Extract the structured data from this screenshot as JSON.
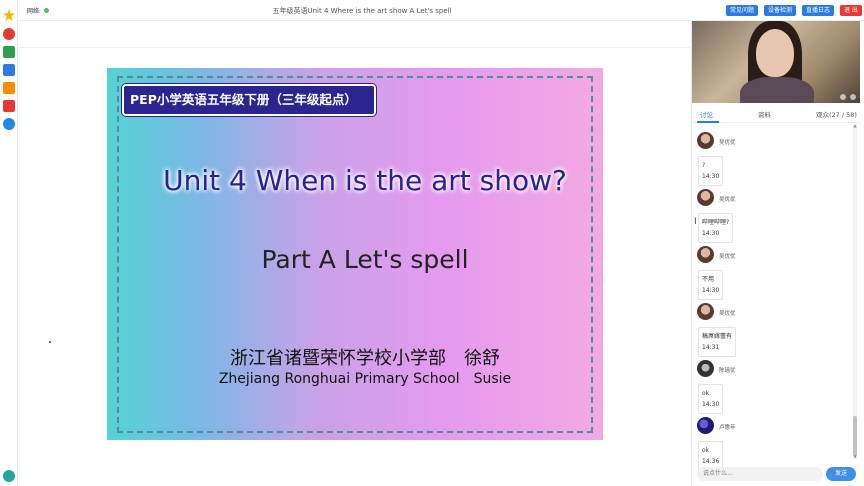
{
  "header": {
    "network_label": "网络:",
    "title": "五年级英语Unit 4 Where is the art show A Let's spell",
    "buttons": [
      "常见问题",
      "设备检测",
      "直播日志",
      "退 出"
    ]
  },
  "slide": {
    "badge": "PEP小学英语五年级下册（三年级起点）",
    "unit_title": "Unit 4 When is the art show?",
    "part_title": "Part A Let's spell",
    "school_cn": "浙江省诸暨荣怀学校小学部　徐舒",
    "school_en": "Zhejiang Ronghuai Primary School　Susie"
  },
  "panel": {
    "tabs": [
      "讨论",
      "资料",
      "观众(27 / 58)"
    ],
    "active_tab": 0
  },
  "chat": [
    {
      "user": "吴优优",
      "lines": [
        "?",
        "14:30"
      ],
      "avatar_color": "#7a4a3a"
    },
    {
      "user": "吴优优",
      "lines": [
        "哔哩哔哩?",
        "14:30"
      ],
      "avatar_color": "#7a4a3a"
    },
    {
      "user": "吴优优",
      "lines": [
        "不用",
        "14:30"
      ],
      "avatar_color": "#7a4a3a"
    },
    {
      "user": "吴优优",
      "lines": [
        "稿屌嫁蕾有",
        "14:31"
      ],
      "avatar_color": "#7a4a3a"
    },
    {
      "user": "陈瑶优",
      "lines": [
        "ok",
        "14:30"
      ],
      "avatar_color": "#555555"
    },
    {
      "user": "卢惠年",
      "lines": [
        "ok",
        "14:36"
      ],
      "avatar_color": "#2d2a8a"
    }
  ],
  "composer": {
    "placeholder": "说点什么…",
    "send_label": "发送"
  },
  "colors": {
    "accent": "#2d7be0",
    "exit": "#e53935",
    "badge_bg": "#2b2590"
  }
}
